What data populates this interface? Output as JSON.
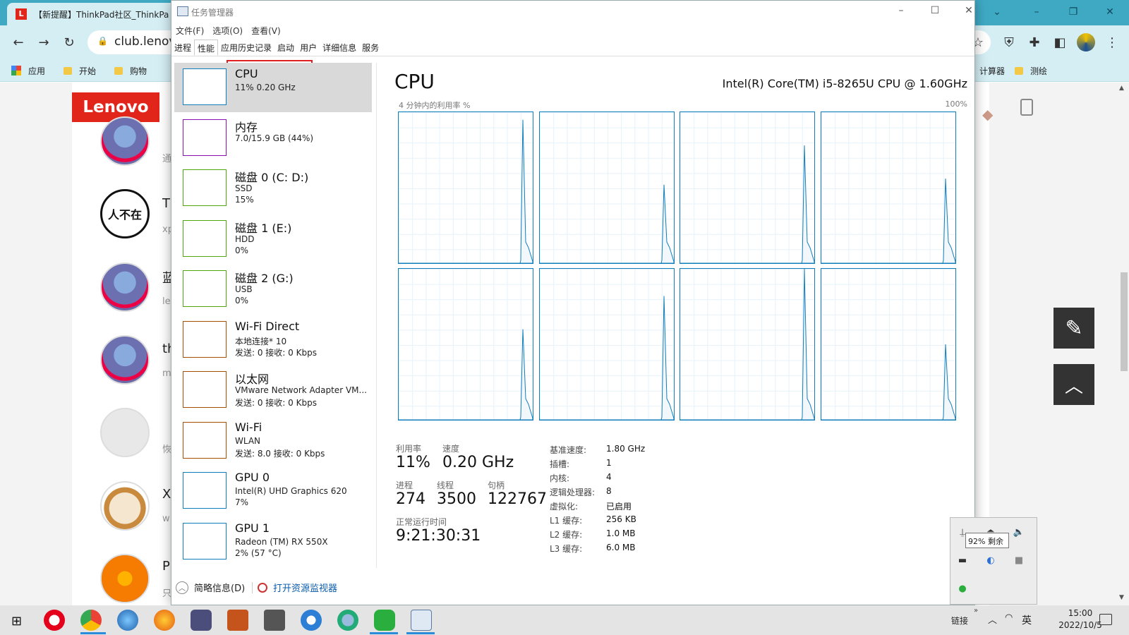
{
  "browser": {
    "tab_title": "【新提醒】ThinkPad社区_ThinkPa",
    "tab_favicon": "L",
    "url": "club.lenov",
    "bookmarks": [
      "应用",
      "开始",
      "购物"
    ],
    "bookmarks_right": [
      "计算器",
      "测绘"
    ]
  },
  "page": {
    "logo": "Lenovo",
    "avatar_text": "人不在",
    "fragments": [
      {
        "big": "",
        "small": "通"
      },
      {
        "big": "T",
        "small": "xp"
      },
      {
        "big": "蓝",
        "small": "le"
      },
      {
        "big": "th",
        "small": "m"
      },
      {
        "big": "",
        "small": "恢"
      },
      {
        "big": "X",
        "small": "w"
      },
      {
        "big": "P",
        "small": "只"
      }
    ]
  },
  "tm": {
    "title": "任务管理器",
    "menu": [
      "文件(F)",
      "选项(O)",
      "查看(V)"
    ],
    "tabs": [
      "进程",
      "性能",
      "应用历史记录",
      "启动",
      "用户",
      "详细信息",
      "服务"
    ],
    "active_tab": "性能",
    "resources": [
      {
        "name": "CPU",
        "l2": "11% 0.20 GHz",
        "l3": "",
        "color": "#117dbb"
      },
      {
        "name": "内存",
        "l2": "7.0/15.9 GB (44%)",
        "l3": "",
        "color": "#8b12ae"
      },
      {
        "name": "磁盘 0 (C: D:)",
        "l2": "SSD",
        "l3": "15%",
        "color": "#4da60c"
      },
      {
        "name": "磁盘 1 (E:)",
        "l2": "HDD",
        "l3": "0%",
        "color": "#4da60c"
      },
      {
        "name": "磁盘 2 (G:)",
        "l2": "USB",
        "l3": "0%",
        "color": "#4da60c"
      },
      {
        "name": "Wi-Fi Direct",
        "l2": "本地连接* 10",
        "l3": "发送: 0 接收: 0 Kbps",
        "color": "#a74f01"
      },
      {
        "name": "以太网",
        "l2": "VMware Network Adapter VM...",
        "l3": "发送: 0 接收: 0 Kbps",
        "color": "#a74f01"
      },
      {
        "name": "Wi-Fi",
        "l2": "WLAN",
        "l3": "发送: 8.0 接收: 0 Kbps",
        "color": "#a74f01"
      },
      {
        "name": "GPU 0",
        "l2": "Intel(R) UHD Graphics 620",
        "l3": "7%",
        "color": "#117dbb"
      },
      {
        "name": "GPU 1",
        "l2": "Radeon (TM) RX 550X",
        "l3": "2% (57 °C)",
        "color": "#117dbb"
      }
    ],
    "cpu": {
      "title": "CPU",
      "model": "Intel(R) Core(TM) i5-8265U CPU @ 1.60GHz",
      "graph_label": "4 分钟内的利用率 %",
      "graph_max": "100%",
      "util_label": "利用率",
      "util": "11%",
      "speed_label": "速度",
      "speed": "0.20 GHz",
      "proc_label": "进程",
      "proc": "274",
      "thread_label": "线程",
      "thread": "3500",
      "handle_label": "句柄",
      "handle": "122767",
      "uptime_label": "正常运行时间",
      "uptime": "9:21:30:31",
      "details": [
        {
          "k": "基准速度:",
          "v": "1.80 GHz"
        },
        {
          "k": "插槽:",
          "v": "1"
        },
        {
          "k": "内核:",
          "v": "4"
        },
        {
          "k": "逻辑处理器:",
          "v": "8"
        },
        {
          "k": "虚拟化:",
          "v": "已启用"
        },
        {
          "k": "L1 缓存:",
          "v": "256 KB"
        },
        {
          "k": "L2 缓存:",
          "v": "1.0 MB"
        },
        {
          "k": "L3 缓存:",
          "v": "6.0 MB"
        }
      ],
      "core_peaks": [
        95,
        52,
        78,
        56,
        60,
        82,
        100,
        50
      ]
    },
    "footer": {
      "brief": "简略信息(D)",
      "resmon": "打开资源监视器"
    }
  },
  "tray": {
    "tooltip": "92% 剩余"
  },
  "taskbar": {
    "links": "链接",
    "ime": "英",
    "time": "15:00",
    "date": "2022/10/5"
  }
}
